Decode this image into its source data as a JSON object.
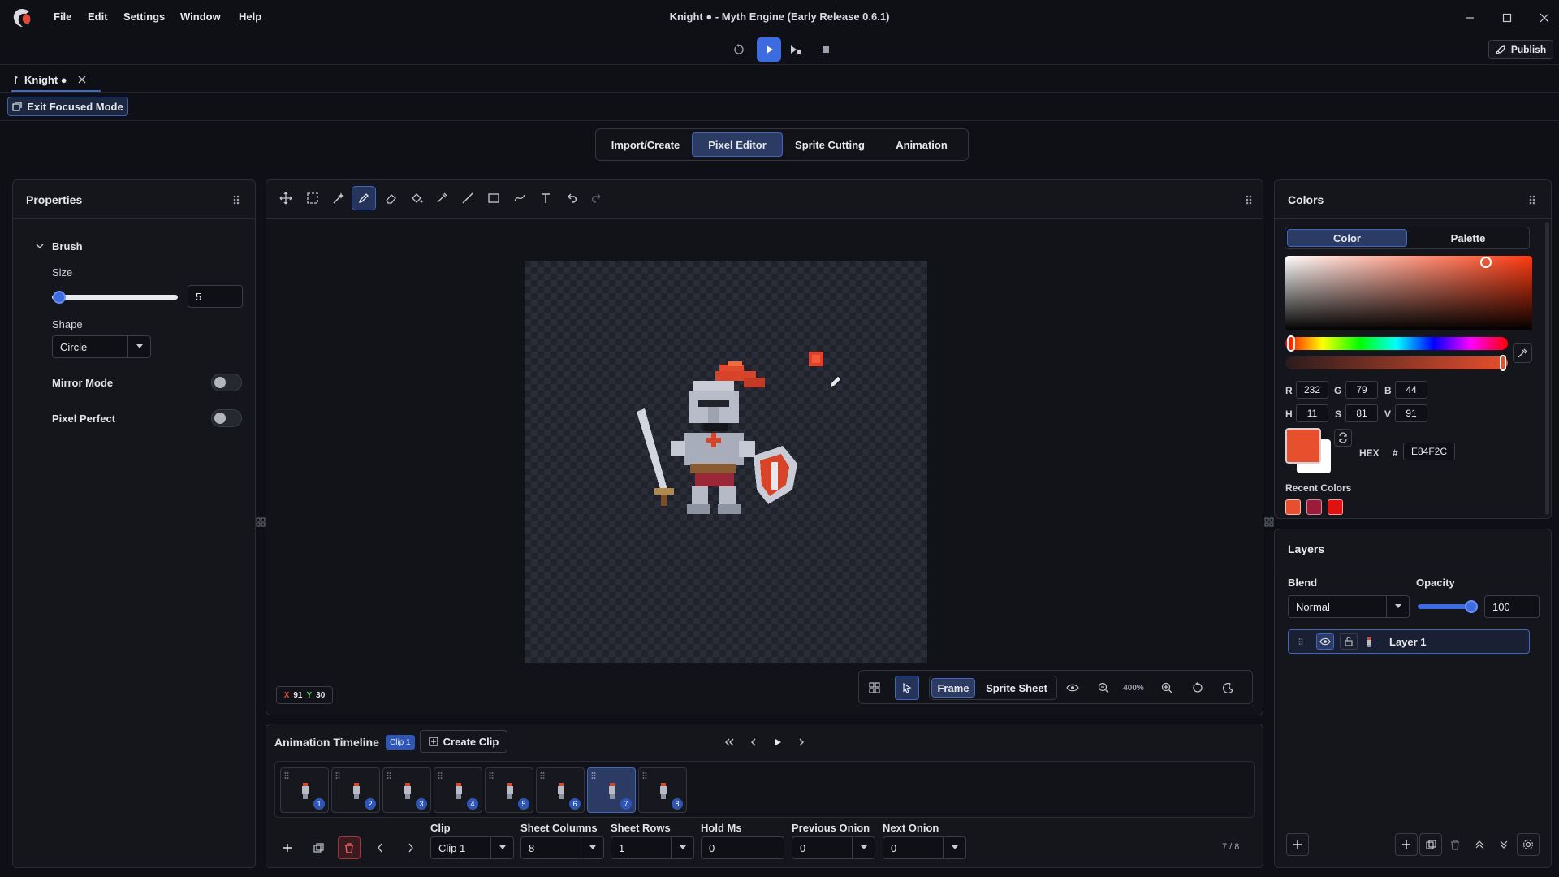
{
  "menu": {
    "file": "File",
    "edit": "Edit",
    "settings": "Settings",
    "window": "Window",
    "help": "Help"
  },
  "window_title": "Knight ● - Myth Engine (Early Release 0.6.1)",
  "publish_label": "Publish",
  "file_tab": {
    "label": "Knight ●"
  },
  "exit_focused_label": "Exit Focused Mode",
  "mode_tabs": [
    "Import/Create",
    "Pixel Editor",
    "Sprite Cutting",
    "Animation"
  ],
  "active_mode": "Pixel Editor",
  "properties": {
    "title": "Properties",
    "section": "Brush",
    "size_label": "Size",
    "size_value": "5",
    "shape_label": "Shape",
    "shape_value": "Circle",
    "mirror_label": "Mirror Mode",
    "mirror_on": false,
    "pixel_perfect_label": "Pixel Perfect",
    "pixel_perfect_on": false
  },
  "tools": [
    "move-icon",
    "marquee-select-icon",
    "magic-wand-icon",
    "pencil-icon",
    "eraser-icon",
    "fill-bucket-icon",
    "eyedropper-icon",
    "line-icon",
    "rectangle-icon",
    "curve-icon",
    "text-icon",
    "undo-icon",
    "redo-icon"
  ],
  "active_tool": "pencil-icon",
  "cursor": {
    "x_label": "X",
    "x": "91",
    "y_label": "Y",
    "y": "30"
  },
  "view": {
    "frame_label": "Frame",
    "sprite_sheet_label": "Sprite Sheet",
    "zoom": "400%",
    "active_view": "Frame"
  },
  "timeline": {
    "title": "Animation Timeline",
    "clip_badge": "Clip 1",
    "create_clip_label": "Create Clip",
    "frames": [
      "1",
      "2",
      "3",
      "4",
      "5",
      "6",
      "7",
      "8"
    ],
    "active_frame": "7",
    "clip_label": "Clip",
    "clip_value": "Clip 1",
    "sheet_columns_label": "Sheet Columns",
    "sheet_columns_value": "8",
    "sheet_rows_label": "Sheet Rows",
    "sheet_rows_value": "1",
    "hold_ms_label": "Hold Ms",
    "hold_ms_value": "0",
    "prev_onion_label": "Previous Onion",
    "prev_onion_value": "0",
    "next_onion_label": "Next Onion",
    "next_onion_value": "0",
    "frame_counter": "7 / 8"
  },
  "colors": {
    "title": "Colors",
    "tab_color": "Color",
    "tab_palette": "Palette",
    "r_label": "R",
    "r": "232",
    "g_label": "G",
    "g": "79",
    "b_label": "B",
    "b": "44",
    "h_label": "H",
    "h": "11",
    "s_label": "S",
    "s": "81",
    "v_label": "V",
    "v": "91",
    "hex_label": "HEX",
    "hash": "#",
    "hex": "E84F2C",
    "primary_color": "#E84F2C",
    "secondary_color": "#FFFFFF",
    "recent_label": "Recent Colors",
    "recent": [
      "#E84F2C",
      "#9B1C3A",
      "#E31010"
    ]
  },
  "layers": {
    "title": "Layers",
    "blend_label": "Blend",
    "blend_value": "Normal",
    "opacity_label": "Opacity",
    "opacity_value": "100",
    "items": [
      {
        "name": "Layer 1"
      }
    ]
  }
}
